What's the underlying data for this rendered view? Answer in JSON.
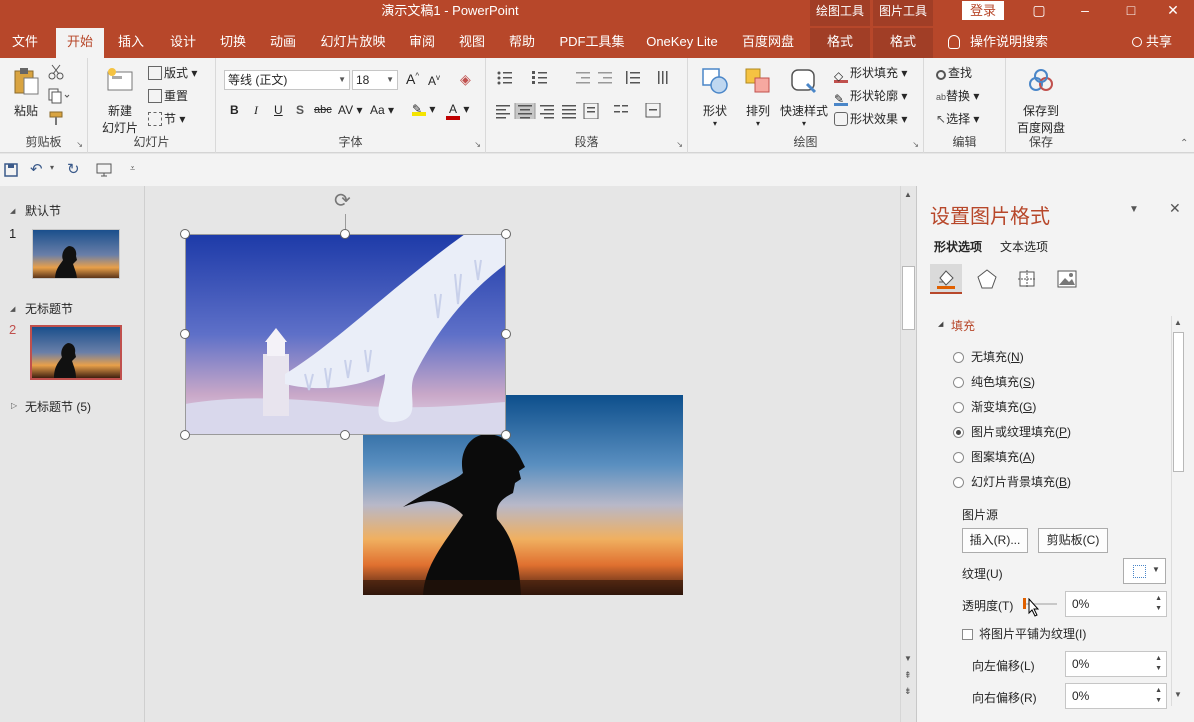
{
  "titlebar": {
    "title": "演示文稿1  -  PowerPoint",
    "drawing_tools": "绘图工具",
    "picture_tools": "图片工具",
    "login": "登录",
    "restore_icon": "▢",
    "minimize": "–",
    "maximize": "□",
    "close": "✕"
  },
  "tabs": [
    "文件",
    "开始",
    "插入",
    "设计",
    "切换",
    "动画",
    "幻灯片放映",
    "审阅",
    "视图",
    "帮助",
    "PDF工具集",
    "OneKey Lite",
    "百度网盘",
    "格式",
    "格式"
  ],
  "tell_me": "操作说明搜索",
  "share": "共享",
  "ribbon": {
    "clipboard": {
      "paste": "粘贴",
      "label": "剪贴板"
    },
    "slides": {
      "new_slide_1": "新建",
      "new_slide_2": "幻灯片",
      "layout": "版式",
      "reset": "重置",
      "section": "节",
      "label": "幻灯片"
    },
    "font": {
      "name": "等线 (正文)",
      "size": "18",
      "label": "字体",
      "bold": "B",
      "italic": "I",
      "underline": "U",
      "shadow": "S",
      "strike": "abc",
      "spacing": "AV",
      "case": "Aa",
      "grow": "A",
      "shrink": "A"
    },
    "paragraph": {
      "label": "段落"
    },
    "drawing": {
      "shapes": "形状",
      "arrange": "排列",
      "quick_styles": "快速样式",
      "shape_fill": "形状填充",
      "shape_outline": "形状轮廓",
      "shape_effects": "形状效果",
      "label": "绘图"
    },
    "editing": {
      "find": "查找",
      "replace": "替换",
      "select": "选择",
      "label": "编辑"
    },
    "save": {
      "save_1": "保存到",
      "save_2": "百度网盘",
      "label": "保存"
    }
  },
  "slides_panel": {
    "section1": "默认节",
    "section2": "无标题节",
    "section3": "无标题节 (5)",
    "num1": "1",
    "num2": "2"
  },
  "pane": {
    "title": "设置图片格式",
    "tab_shape": "形状选项",
    "tab_text": "文本选项",
    "fill_header": "填充",
    "options": [
      {
        "label": "无填充",
        "key": "N"
      },
      {
        "label": "纯色填充",
        "key": "S"
      },
      {
        "label": "渐变填充",
        "key": "G"
      },
      {
        "label": "图片或纹理填充",
        "key": "P"
      },
      {
        "label": "图案填充",
        "key": "A"
      },
      {
        "label": "幻灯片背景填充",
        "key": "B"
      }
    ],
    "selected_option": 3,
    "picture_source": "图片源",
    "insert_btn": "插入(R)...",
    "clipboard_btn": "剪贴板(C)",
    "texture_label": "纹理(U)",
    "transparency_label": "透明度(T)",
    "transparency_value": "0%",
    "tile_label": "将图片平铺为纹理(I)",
    "offset_left_label": "向左偏移(L)",
    "offset_left_value": "0%",
    "offset_right_label": "向右偏移(R)",
    "offset_right_value": "0%"
  },
  "colors": {
    "accent": "#b7472a",
    "accent_dark": "#a13e26",
    "ribbon": "#f3f3f3",
    "canvas": "#e6e6e6"
  }
}
